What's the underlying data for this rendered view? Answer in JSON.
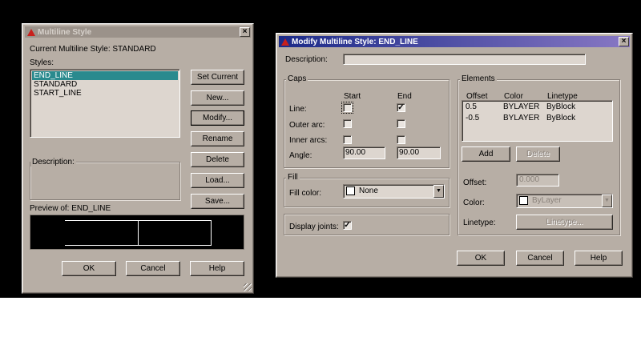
{
  "multiline_style": {
    "title": "Multiline Style",
    "current_style_label": "Current Multiline Style: STANDARD",
    "styles_label": "Styles:",
    "styles": [
      "END_LINE",
      "STANDARD",
      "START_LINE"
    ],
    "selected_style": "END_LINE",
    "description_label": "Description:",
    "preview_label": "Preview of: END_LINE",
    "buttons": {
      "set_current": "Set Current",
      "new": "New...",
      "modify": "Modify...",
      "rename": "Rename",
      "delete": "Delete",
      "load": "Load...",
      "save": "Save...",
      "ok": "OK",
      "cancel": "Cancel",
      "help": "Help"
    }
  },
  "modify_style": {
    "title": "Modify Multiline Style: END_LINE",
    "description_label": "Description:",
    "description_value": "",
    "caps": {
      "title": "Caps",
      "start_header": "Start",
      "end_header": "End",
      "line_label": "Line:",
      "outer_arc_label": "Outer arc:",
      "inner_arcs_label": "Inner arcs:",
      "angle_label": "Angle:",
      "line_start": false,
      "line_end": true,
      "angle_start": "90.00",
      "angle_end": "90.00"
    },
    "fill": {
      "title": "Fill",
      "fill_color_label": "Fill color:",
      "fill_color_value": "None",
      "swatch_color": "#ffffff"
    },
    "display_joints_label": "Display joints:",
    "display_joints": true,
    "elements": {
      "title": "Elements",
      "headers": [
        "Offset",
        "Color",
        "Linetype"
      ],
      "rows": [
        {
          "offset": "0.5",
          "color": "BYLAYER",
          "linetype": "ByBlock"
        },
        {
          "offset": "-0.5",
          "color": "BYLAYER",
          "linetype": "ByBlock"
        }
      ],
      "add_button": "Add",
      "delete_button": "Delete",
      "offset_label": "Offset:",
      "offset_value": "0.000",
      "color_label": "Color:",
      "color_value": "ByLayer",
      "linetype_label": "Linetype:",
      "linetype_button": "Linetype..."
    },
    "buttons": {
      "ok": "OK",
      "cancel": "Cancel",
      "help": "Help"
    }
  },
  "colors": {
    "dialog_bg": "#b7aea5",
    "selection": "#2a8a8e",
    "active_title_start": "#1b2a88",
    "active_title_end": "#8878c4"
  }
}
